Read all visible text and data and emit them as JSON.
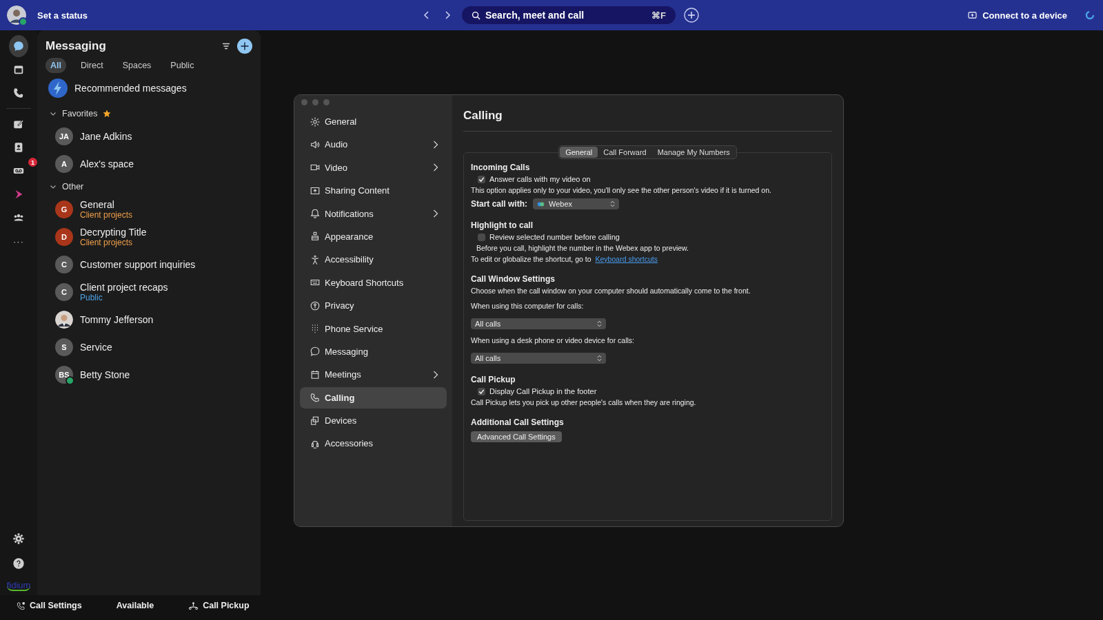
{
  "top_bar": {
    "status_label": "Set a status",
    "search": {
      "placeholder": "Search, meet and call",
      "shortcut": "⌘F"
    },
    "connect_label": "Connect to a device"
  },
  "rail": {
    "items": [
      {
        "selected": true
      },
      {
        "selected": false
      },
      {
        "selected": false
      },
      {
        "selected": false
      },
      {
        "selected": false
      },
      {
        "selected": false,
        "badge": "1"
      },
      {
        "selected": false
      },
      {
        "selected": false
      },
      {
        "selected": false,
        "label": "···"
      }
    ],
    "brand": "fidium"
  },
  "messaging": {
    "title": "Messaging",
    "filters": [
      {
        "label": "All",
        "selected": true
      },
      {
        "label": "Direct",
        "selected": false
      },
      {
        "label": "Spaces",
        "selected": false
      },
      {
        "label": "Public",
        "selected": false
      }
    ],
    "recommended": "Recommended messages",
    "sections": [
      {
        "label": "Favorites",
        "expanded": true,
        "starred": true,
        "items": [
          {
            "initials": "JA",
            "name": "Jane Adkins",
            "color": "#5a5a5a",
            "online": false
          },
          {
            "initials": "A",
            "name": "Alex's space",
            "color": "#5a5a5a",
            "online": false
          }
        ]
      },
      {
        "label": "Other",
        "expanded": true,
        "starred": false,
        "items": [
          {
            "initials": "G",
            "name": "General",
            "subtitle": {
              "text": "Client projects",
              "color": "#f0a04b"
            },
            "color": "#a9361a",
            "online": false
          },
          {
            "initials": "D",
            "name": "Decrypting Title",
            "subtitle": {
              "text": "Client projects",
              "color": "#f0a04b"
            },
            "color": "#a9361a",
            "online": false
          },
          {
            "initials": "C",
            "name": "Customer support inquiries",
            "color": "#5a5a5a",
            "online": false
          },
          {
            "initials": "C",
            "name": "Client project recaps",
            "subtitle": {
              "text": "Public",
              "color": "#4aa3e8"
            },
            "color": "#5a5a5a",
            "online": false
          },
          {
            "kind": "picture",
            "name": "Tommy Jefferson",
            "online": false
          },
          {
            "initials": "S",
            "name": "Service",
            "color": "#5a5a5a",
            "online": false
          },
          {
            "initials": "BS",
            "name": "Betty Stone",
            "color": "#5a5a5a",
            "online": true
          }
        ]
      }
    ]
  },
  "footer": {
    "items": [
      "Call Settings",
      "Available",
      "Call Pickup"
    ]
  },
  "settings_window": {
    "nav": [
      {
        "label": "General",
        "selected": false,
        "submenu": false
      },
      {
        "label": "Audio",
        "selected": false,
        "submenu": true
      },
      {
        "label": "Video",
        "selected": false,
        "submenu": true
      },
      {
        "label": "Sharing Content",
        "selected": false,
        "submenu": false
      },
      {
        "label": "Notifications",
        "selected": false,
        "submenu": true
      },
      {
        "label": "Appearance",
        "selected": false,
        "submenu": false
      },
      {
        "label": "Accessibility",
        "selected": false,
        "submenu": false
      },
      {
        "label": "Keyboard Shortcuts",
        "selected": false,
        "submenu": false
      },
      {
        "label": "Privacy",
        "selected": false,
        "submenu": false
      },
      {
        "label": "Phone Service",
        "selected": false,
        "submenu": false
      },
      {
        "label": "Messaging",
        "selected": false,
        "submenu": false
      },
      {
        "label": "Meetings",
        "selected": false,
        "submenu": true
      },
      {
        "label": "Calling",
        "selected": true,
        "submenu": false
      },
      {
        "label": "Devices",
        "selected": false,
        "submenu": false
      },
      {
        "label": "Accessories",
        "selected": false,
        "submenu": false
      }
    ],
    "title": "Calling",
    "tabs": [
      {
        "label": "General",
        "selected": true
      },
      {
        "label": "Call Forward",
        "selected": false
      },
      {
        "label": "Manage My Numbers",
        "selected": false
      }
    ],
    "incoming": {
      "heading": "Incoming Calls",
      "checkbox": {
        "label": "Answer calls with my video on",
        "checked": true
      },
      "note": "This option applies only to your video, you'll only see the other person's video if it is turned on.",
      "start_label": "Start call with:",
      "start_value": "Webex"
    },
    "highlight": {
      "heading": "Highlight to call",
      "checkbox": {
        "label": "Review selected number before calling",
        "checked": false
      },
      "note": "Before you call, highlight the number in the Webex app to preview.",
      "shortcut_text": "To edit or globalize the shortcut, go to",
      "shortcut_link": "Keyboard shortcuts"
    },
    "call_window": {
      "heading": "Call Window Settings",
      "note": "Choose when the call window on your computer should automatically come to the front.",
      "computer_label": "When using this computer for calls:",
      "computer_value": "All calls",
      "desk_label": "When using a desk phone or video device for calls:",
      "desk_value": "All calls"
    },
    "pickup": {
      "heading": "Call Pickup",
      "checkbox": {
        "label": "Display Call Pickup in the footer",
        "checked": true
      },
      "note": "Call Pickup lets you pick up other people's calls when they are ringing."
    },
    "additional": {
      "heading": "Additional Call Settings",
      "button": "Advanced Call Settings"
    }
  }
}
